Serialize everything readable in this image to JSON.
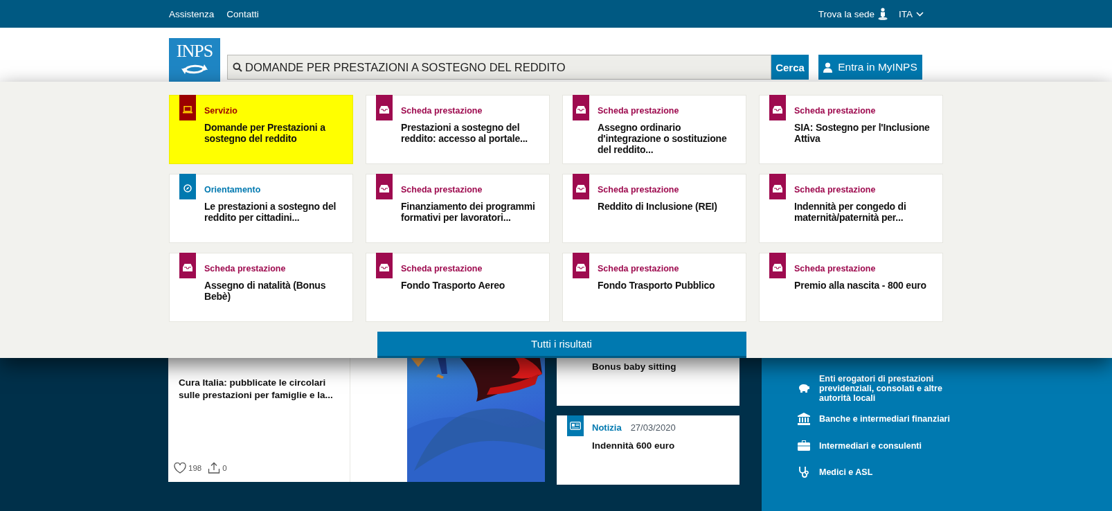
{
  "top_bar": {
    "links": [
      "Assistenza",
      "Contatti"
    ],
    "locator": "Trova la sede",
    "language": "ITA"
  },
  "header": {
    "logo": "INPS",
    "search": {
      "value": "DOMANDE PER PRESTAZIONI A SOSTEGNO DEL REDDITO",
      "button": "Cerca"
    },
    "login_button": "Entra in MyINPS"
  },
  "results": {
    "cards": [
      {
        "kind": "servizio",
        "category": "Servizio",
        "title": "Domande per Prestazioni a sostegno del reddito",
        "selected": true
      },
      {
        "kind": "scheda",
        "category": "Scheda prestazione",
        "title": "Prestazioni a sostegno del reddito: accesso al portale...",
        "selected": false
      },
      {
        "kind": "scheda",
        "category": "Scheda prestazione",
        "title": "Assegno ordinario d'integrazione o sostituzione del reddito...",
        "selected": false
      },
      {
        "kind": "scheda",
        "category": "Scheda prestazione",
        "title": "SIA: Sostegno per l'Inclusione Attiva",
        "selected": false
      },
      {
        "kind": "orientamento",
        "category": "Orientamento",
        "title": "Le prestazioni a sostegno del reddito per cittadini...",
        "selected": false
      },
      {
        "kind": "scheda",
        "category": "Scheda prestazione",
        "title": "Finanziamento dei programmi formativi per lavoratori...",
        "selected": false
      },
      {
        "kind": "scheda",
        "category": "Scheda prestazione",
        "title": "Reddito di Inclusione (REI)",
        "selected": false
      },
      {
        "kind": "scheda",
        "category": "Scheda prestazione",
        "title": "Indennità per congedo di maternità/paternità per...",
        "selected": false
      },
      {
        "kind": "scheda",
        "category": "Scheda prestazione",
        "title": "Assegno di natalità (Bonus Bebè)",
        "selected": false
      },
      {
        "kind": "scheda",
        "category": "Scheda prestazione",
        "title": "Fondo Trasporto Aereo",
        "selected": false
      },
      {
        "kind": "scheda",
        "category": "Scheda prestazione",
        "title": "Fondo Trasporto Pubblico",
        "selected": false
      },
      {
        "kind": "scheda",
        "category": "Scheda prestazione",
        "title": "Premio alla nascita - 800 euro",
        "selected": false
      }
    ],
    "all_button": "Tutti i risultati"
  },
  "feature_card": {
    "title": "Cura Italia: pubblicate le circolari sulle prestazioni per famiglie e la...",
    "likes": "198",
    "shares": "0"
  },
  "news_cards": [
    {
      "title": "Bonus baby sitting"
    },
    {
      "category": "Notizia",
      "date": "27/03/2020",
      "title": "Indennità 600 euro"
    }
  ],
  "audience_links": [
    {
      "kind": "piggy",
      "label": "Enti erogatori di prestazioni previdenziali, consolati e altre autorità locali"
    },
    {
      "kind": "bank",
      "label": "Banche e intermediari finanziari"
    },
    {
      "kind": "briefcase",
      "label": "Intermediari e consulenti"
    },
    {
      "kind": "stethoscope",
      "label": "Medici e ASL"
    }
  ]
}
